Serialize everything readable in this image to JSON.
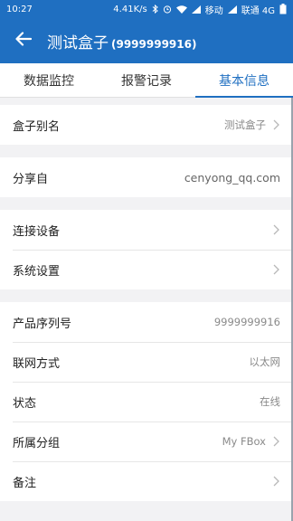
{
  "status_bar": {
    "time": "10:27",
    "speed": "4.41K/s",
    "carrier1": "移动",
    "carrier2": "联通 4G",
    "icons": [
      "bluetooth-icon",
      "alarm-icon",
      "wifi-icon",
      "signal-icon",
      "signal-icon",
      "battery-icon"
    ]
  },
  "app_bar": {
    "title": "测试盒子",
    "subtitle": "(9999999916)"
  },
  "tabs": [
    {
      "label": "数据监控",
      "active": false
    },
    {
      "label": "报警记录",
      "active": false
    },
    {
      "label": "基本信息",
      "active": true
    }
  ],
  "sections": {
    "alias": {
      "label": "盒子别名",
      "value": "测试盒子"
    },
    "share": {
      "label": "分享自",
      "value": "cenyong_qq.com"
    },
    "connect": {
      "label": "连接设备"
    },
    "system": {
      "label": "系统设置"
    },
    "serial": {
      "label": "产品序列号",
      "value": "9999999916"
    },
    "network": {
      "label": "联网方式",
      "value": "以太网"
    },
    "status": {
      "label": "状态",
      "value": "在线"
    },
    "group": {
      "label": "所属分组",
      "value": "My FBox"
    },
    "note": {
      "label": "备注"
    }
  },
  "colors": {
    "primary": "#1f6fc1",
    "background": "#f2f2f4",
    "text": "#222222",
    "muted": "#8a8a8a"
  }
}
